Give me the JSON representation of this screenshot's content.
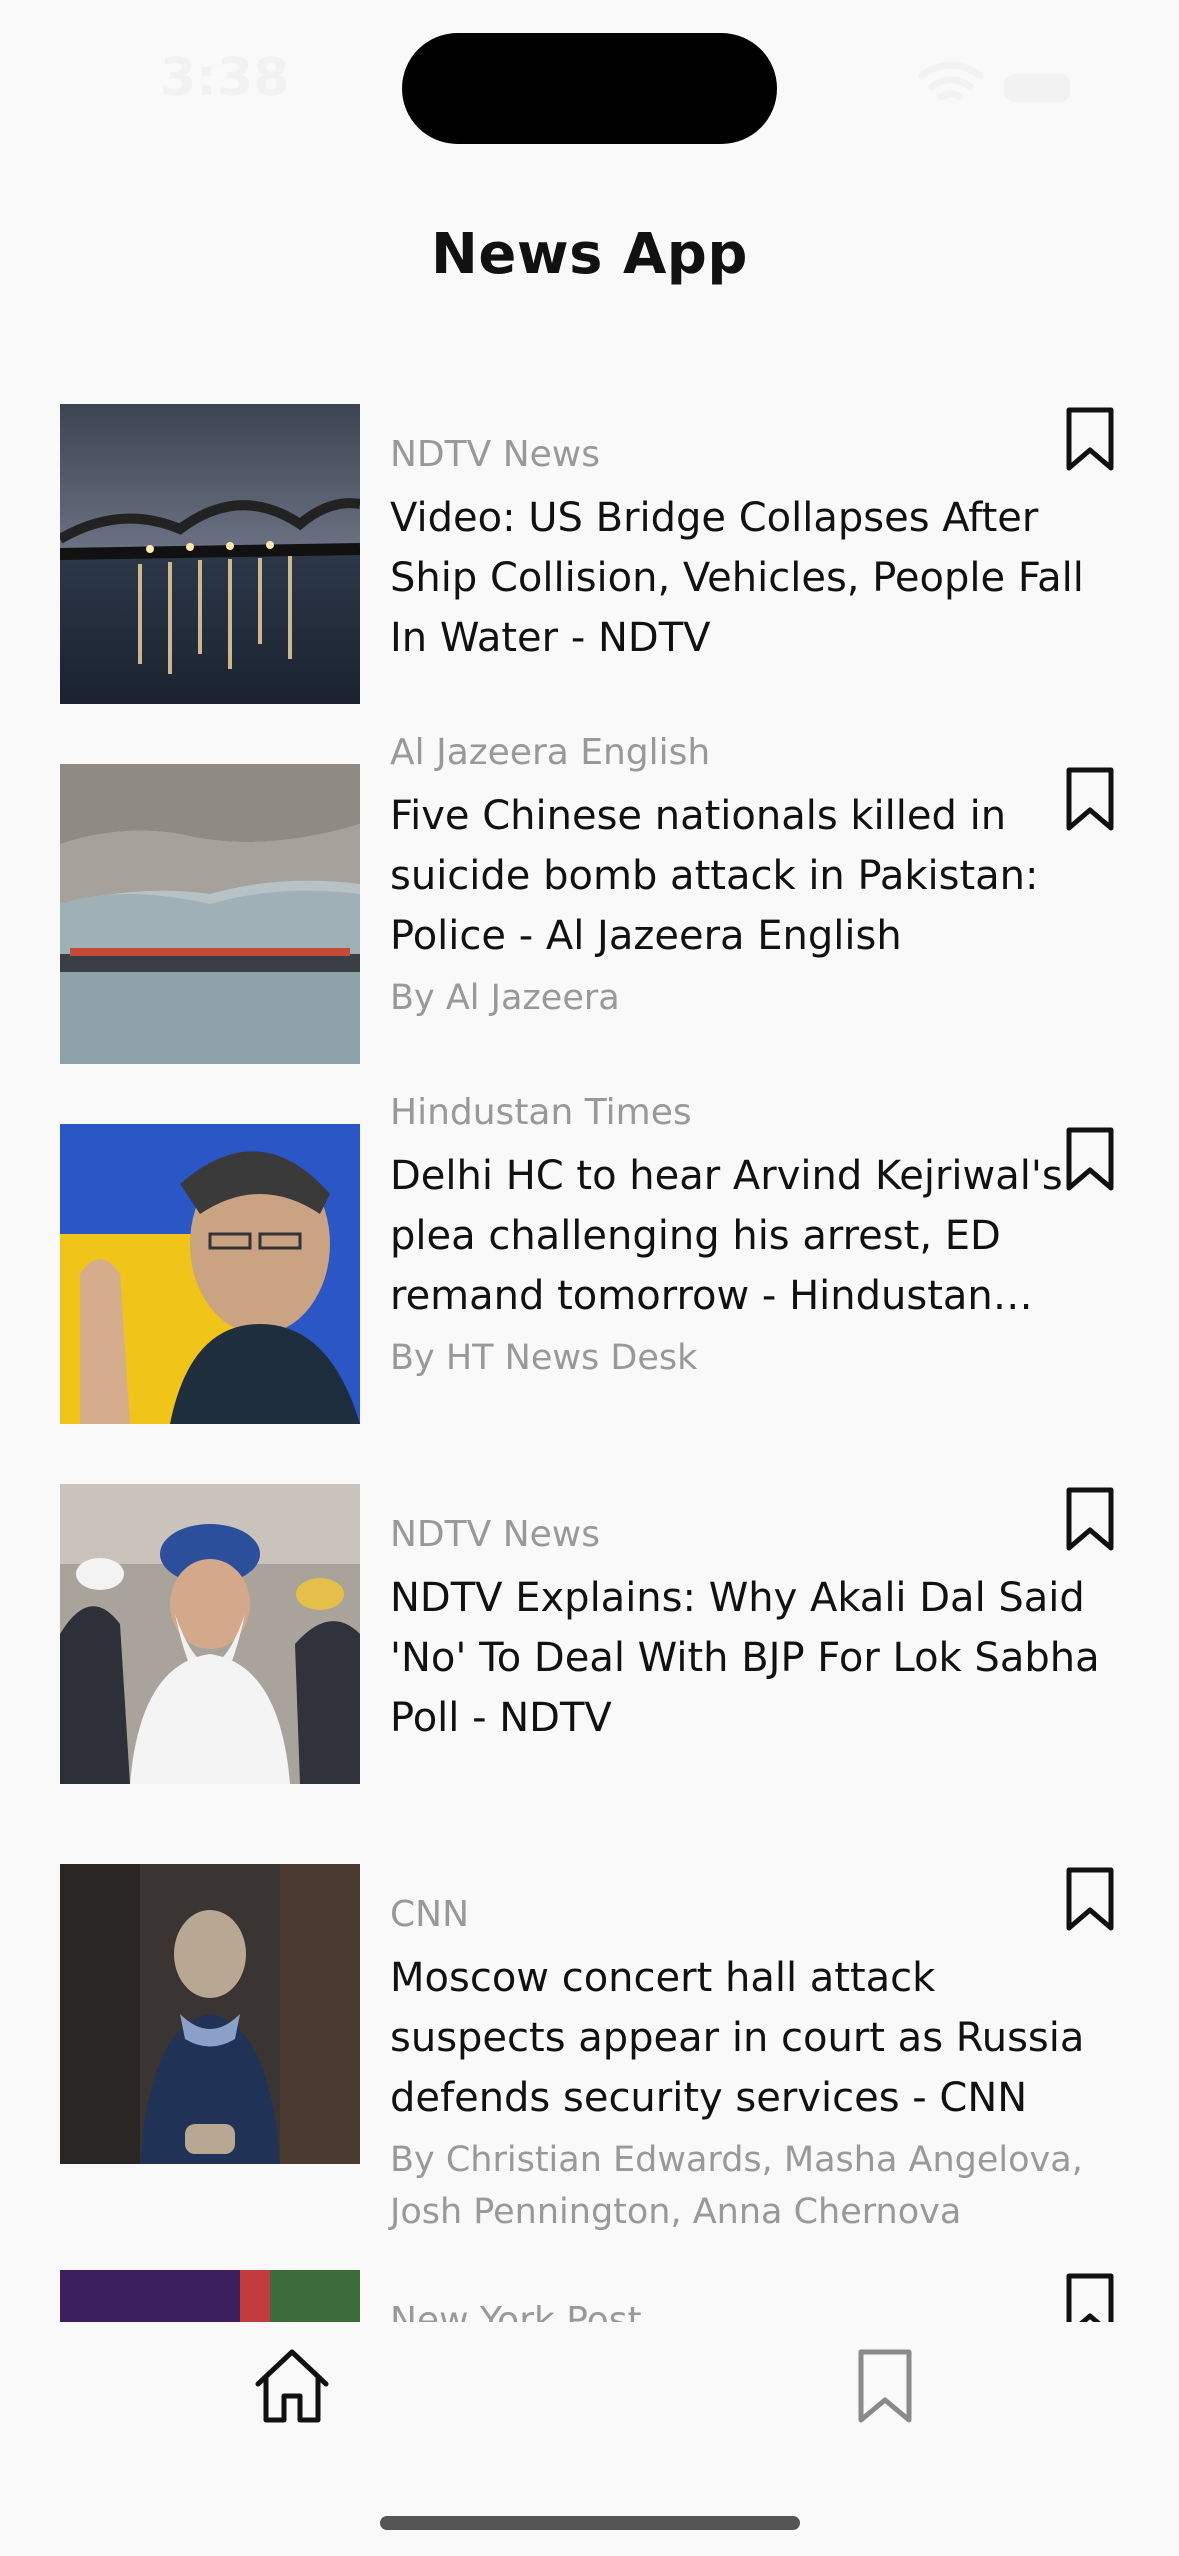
{
  "status_bar": {
    "time": "3:38"
  },
  "app": {
    "title": "News App"
  },
  "articles": [
    {
      "source": "NDTV News",
      "title": "Video: US Bridge Collapses After Ship Collision, Vehicles, People Fall In Water - NDTV",
      "author": ""
    },
    {
      "source": "Al Jazeera English",
      "title": "Five Chinese nationals killed in suicide bomb attack in Pakistan: Police - Al Jazeera English",
      "author": "By Al Jazeera"
    },
    {
      "source": "Hindustan Times",
      "title": "Delhi HC to hear Arvind Kejriwal's plea challenging his arrest, ED remand tomorrow - Hindustan Times",
      "author": "By HT News Desk"
    },
    {
      "source": "NDTV News",
      "title": "NDTV Explains: Why Akali Dal Said 'No' To Deal With BJP For Lok Sabha Poll - NDTV",
      "author": ""
    },
    {
      "source": "CNN",
      "title": "Moscow concert hall attack suspects appear in court as Russia defends security services - CNN",
      "author": "By Christian Edwards, Masha Angelova, Josh Pennington, Anna Chernova"
    },
    {
      "source": "New York Post",
      "title": "",
      "author": ""
    }
  ],
  "bottom_nav": {
    "home_icon": "home-icon",
    "saved_icon": "bookmark-icon"
  }
}
